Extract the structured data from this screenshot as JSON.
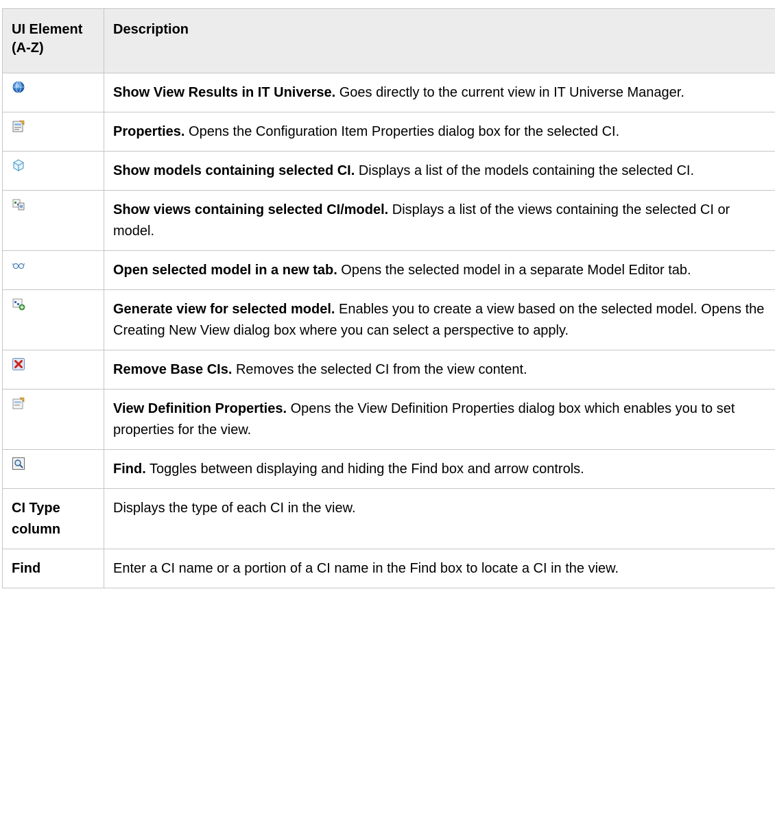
{
  "header": {
    "col1": "UI Element (A-Z)",
    "col2": "Description"
  },
  "rows": [
    {
      "icon": "globe-icon",
      "lead": "Show View Results in IT Universe.",
      "text": " Goes directly to the current view in IT Universe Manager."
    },
    {
      "icon": "properties-icon",
      "lead": "Properties.",
      "text": " Opens the Configuration Item Properties dialog box for the selected CI."
    },
    {
      "icon": "cube-icon",
      "lead": "Show models containing selected CI.",
      "text": " Displays a list of the models containing the selected CI."
    },
    {
      "icon": "views-icon",
      "lead": "Show views containing selected CI/model.",
      "text": " Displays a list of the views containing the selected CI or model."
    },
    {
      "icon": "glasses-icon",
      "lead": "Open selected model in a new tab.",
      "text": " Opens the selected model in a separate Model Editor tab."
    },
    {
      "icon": "generate-view-icon",
      "lead": "Generate view for selected model.",
      "text": " Enables you to create a view based on the selected model. Opens the Creating New View dialog box where you can select a perspective to apply."
    },
    {
      "icon": "remove-icon",
      "lead": "Remove Base CIs.",
      "text": " Removes the selected CI from the view content."
    },
    {
      "icon": "view-definition-icon",
      "lead": "View Definition Properties.",
      "text": " Opens the View Definition Properties dialog box which enables you to set properties for the view."
    },
    {
      "icon": "find-icon",
      "lead": "Find.",
      "text": " Toggles between displaying and hiding the Find box and arrow controls."
    },
    {
      "element": "CI Type column",
      "text": "Displays the type of each CI in the view."
    },
    {
      "element": "Find",
      "text": "Enter a CI name or a portion of a CI name in the Find box to locate a CI in the view."
    }
  ]
}
